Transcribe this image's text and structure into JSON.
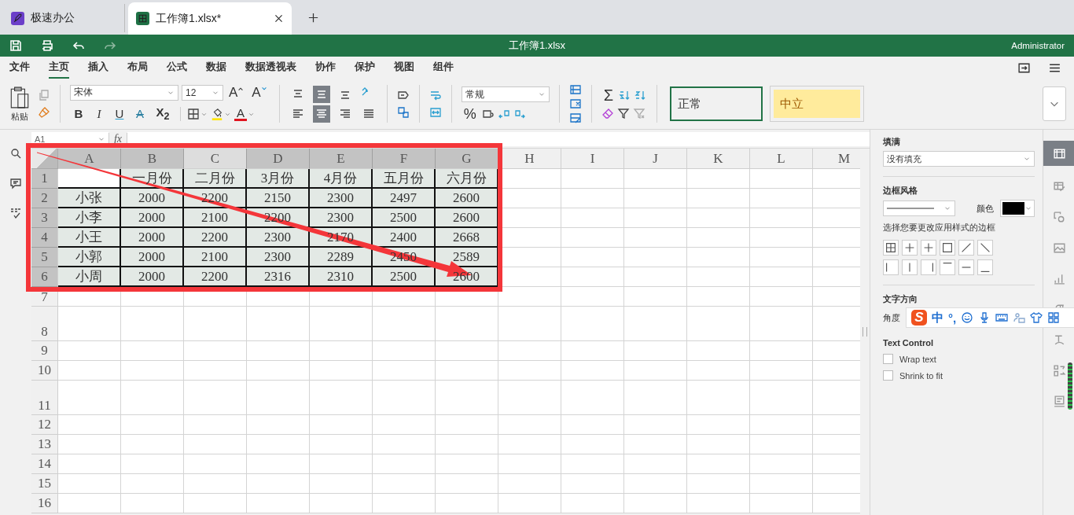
{
  "app_tabs": [
    {
      "label": "极速办公",
      "selected": false,
      "kind": "home"
    },
    {
      "label": "工作簿1.xlsx*",
      "selected": true,
      "kind": "sheet"
    }
  ],
  "title_bar": {
    "title": "工作簿1.xlsx",
    "user": "Administrator"
  },
  "menu": [
    {
      "label": "文件",
      "selected": false
    },
    {
      "label": "主页",
      "selected": true
    },
    {
      "label": "插入",
      "selected": false
    },
    {
      "label": "布局",
      "selected": false
    },
    {
      "label": "公式",
      "selected": false
    },
    {
      "label": "数据",
      "selected": false
    },
    {
      "label": "数据透视表",
      "selected": false
    },
    {
      "label": "协作",
      "selected": false
    },
    {
      "label": "保护",
      "selected": false
    },
    {
      "label": "视图",
      "selected": false
    },
    {
      "label": "组件",
      "selected": false
    }
  ],
  "ribbon": {
    "paste_label": "粘贴",
    "font_name": "宋体",
    "font_size": "12",
    "grow_font": "A",
    "shrink_font": "A",
    "format_buttons": [
      {
        "label": "B",
        "kind": "bold"
      },
      {
        "label": "I",
        "kind": "italic"
      },
      {
        "label": "U",
        "kind": "underline"
      },
      {
        "label": "A",
        "kind": "strike"
      },
      {
        "label": "X$_{2}$",
        "kind": "subscript"
      }
    ],
    "font_color": "A",
    "align_buttons": [
      {
        "kind": "top",
        "selected": false
      },
      {
        "kind": "middle",
        "selected": true
      },
      {
        "kind": "bottom",
        "selected": false
      },
      {
        "kind": "left",
        "selected": false
      },
      {
        "kind": "center",
        "selected": true
      },
      {
        "kind": "right",
        "selected": false
      },
      {
        "kind": "justify",
        "selected": false
      }
    ],
    "number_format": "常规",
    "percent": "%",
    "sum": "Σ",
    "styles": [
      {
        "label": "正常",
        "kind": "normal"
      },
      {
        "label": "中立",
        "kind": "neutral"
      }
    ]
  },
  "formula_bar": {
    "name_box": "A1",
    "fx": "fx"
  },
  "sheet": {
    "columns": [
      {
        "label": "A",
        "selected": true,
        "hover": false
      },
      {
        "label": "B",
        "selected": true,
        "hover": false
      },
      {
        "label": "C",
        "selected": true,
        "hover": true
      },
      {
        "label": "D",
        "selected": true,
        "hover": false
      },
      {
        "label": "E",
        "selected": true,
        "hover": false
      },
      {
        "label": "F",
        "selected": true,
        "hover": false
      },
      {
        "label": "G",
        "selected": true,
        "hover": false
      },
      {
        "label": "H",
        "selected": false,
        "hover": false
      },
      {
        "label": "I",
        "selected": false,
        "hover": false
      },
      {
        "label": "J",
        "selected": false,
        "hover": false
      },
      {
        "label": "K",
        "selected": false,
        "hover": false
      },
      {
        "label": "L",
        "selected": false,
        "hover": false
      },
      {
        "label": "M",
        "selected": false,
        "hover": false
      }
    ],
    "rows": [
      {
        "label": "1",
        "selected": true,
        "tall": false,
        "cells": [
          null,
          "一月份",
          "二月份",
          "3月份",
          "4月份",
          "五月份",
          "六月份"
        ]
      },
      {
        "label": "2",
        "selected": true,
        "tall": false,
        "cells": [
          "小张",
          "2000",
          "2200",
          "2150",
          "2300",
          "2497",
          "2600"
        ]
      },
      {
        "label": "3",
        "selected": true,
        "tall": false,
        "cells": [
          "小李",
          "2000",
          "2100",
          "2200",
          "2300",
          "2500",
          "2600"
        ]
      },
      {
        "label": "4",
        "selected": true,
        "tall": false,
        "cells": [
          "小王",
          "2000",
          "2200",
          "2300",
          "2170",
          "2400",
          "2668"
        ]
      },
      {
        "label": "5",
        "selected": true,
        "tall": false,
        "cells": [
          "小郭",
          "2000",
          "2100",
          "2300",
          "2289",
          "2450",
          "2589"
        ]
      },
      {
        "label": "6",
        "selected": true,
        "tall": false,
        "cells": [
          "小周",
          "2000",
          "2200",
          "2316",
          "2310",
          "2500",
          "2600"
        ]
      },
      {
        "label": "7",
        "selected": false,
        "tall": false,
        "cells": []
      },
      {
        "label": "8",
        "selected": false,
        "tall": true,
        "cells": []
      },
      {
        "label": "9",
        "selected": false,
        "tall": false,
        "cells": []
      },
      {
        "label": "10",
        "selected": false,
        "tall": false,
        "cells": []
      },
      {
        "label": "11",
        "selected": false,
        "tall": true,
        "cells": []
      },
      {
        "label": "12",
        "selected": false,
        "tall": false,
        "cells": []
      },
      {
        "label": "13",
        "selected": false,
        "tall": false,
        "cells": []
      },
      {
        "label": "14",
        "selected": false,
        "tall": false,
        "cells": []
      },
      {
        "label": "15",
        "selected": false,
        "tall": false,
        "cells": []
      },
      {
        "label": "16",
        "selected": false,
        "tall": false,
        "cells": []
      }
    ]
  },
  "side_panel": {
    "fill_title": "填满",
    "fill_value": "没有填充",
    "border_title": "边框风格",
    "color_label": "颜色",
    "border_hint": "选择您要更改应用样式的边框",
    "text_direction_title": "文字方向",
    "angle_label": "角度",
    "text_control_title": "Text Control",
    "options": [
      {
        "label": "Wrap text",
        "checked": false
      },
      {
        "label": "Shrink to fit",
        "checked": false
      }
    ]
  },
  "side_tabs": [
    {
      "selected": true
    },
    {
      "selected": false
    },
    {
      "selected": false
    },
    {
      "selected": false
    },
    {
      "selected": false
    },
    {
      "selected": false
    },
    {
      "selected": false
    },
    {
      "selected": false
    },
    {
      "selected": false
    }
  ],
  "ime_toolbar": {
    "logo": "S",
    "mode": "中",
    "punctuation": "°,"
  }
}
